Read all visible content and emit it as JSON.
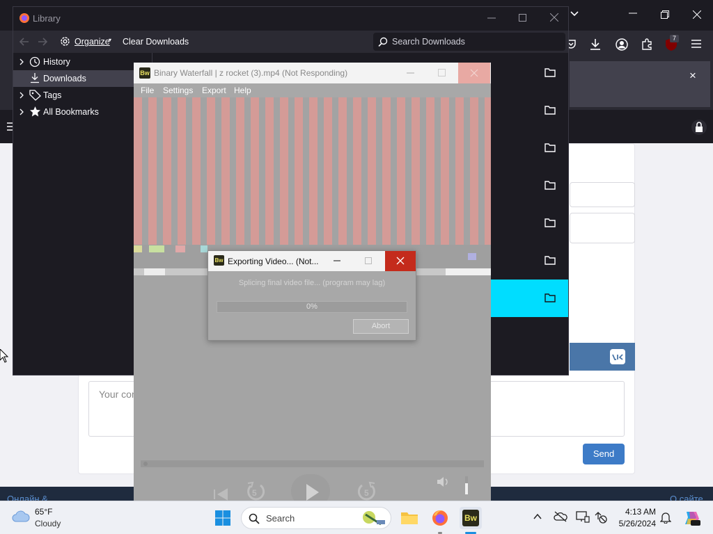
{
  "firefox_bg": {
    "notification_close": "×",
    "extensions_badge": "7",
    "comment_placeholder": "Your com",
    "send_label": "Send",
    "footer_left": "Онлайн &",
    "footer_right": "О сайте"
  },
  "library": {
    "title": "Library",
    "toolbar": {
      "organize_label": "Organize",
      "clear_downloads_label": "Clear Downloads",
      "search_placeholder": "Search Downloads"
    },
    "sidebar": [
      {
        "label": "History",
        "icon": "clock-icon"
      },
      {
        "label": "Downloads",
        "icon": "download-icon"
      },
      {
        "label": "Tags",
        "icon": "tag-icon"
      },
      {
        "label": "All Bookmarks",
        "icon": "star-icon"
      }
    ]
  },
  "binary_waterfall": {
    "app_icon_text": "Bw",
    "title": "Binary Waterfall | z rocket (3).mp4 (Not Responding)",
    "menu": [
      "File",
      "Settings",
      "Export",
      "Help"
    ],
    "rewind_label": "5",
    "forward_label": "5"
  },
  "export_dialog": {
    "title": "Exporting Video... (Not...",
    "message": "Splicing final video file... (program may lag)",
    "progress_text": "0%",
    "progress": 0,
    "abort_label": "Abort"
  },
  "taskbar": {
    "weather_temp": "65°F",
    "weather_desc": "Cloudy",
    "search_placeholder": "Search",
    "time": "4:13 AM",
    "date": "5/26/2024"
  },
  "colors": {
    "download_selected": "#00ddff",
    "close_red": "#c42b1c",
    "waterfall_stripe": "#d49b97"
  }
}
